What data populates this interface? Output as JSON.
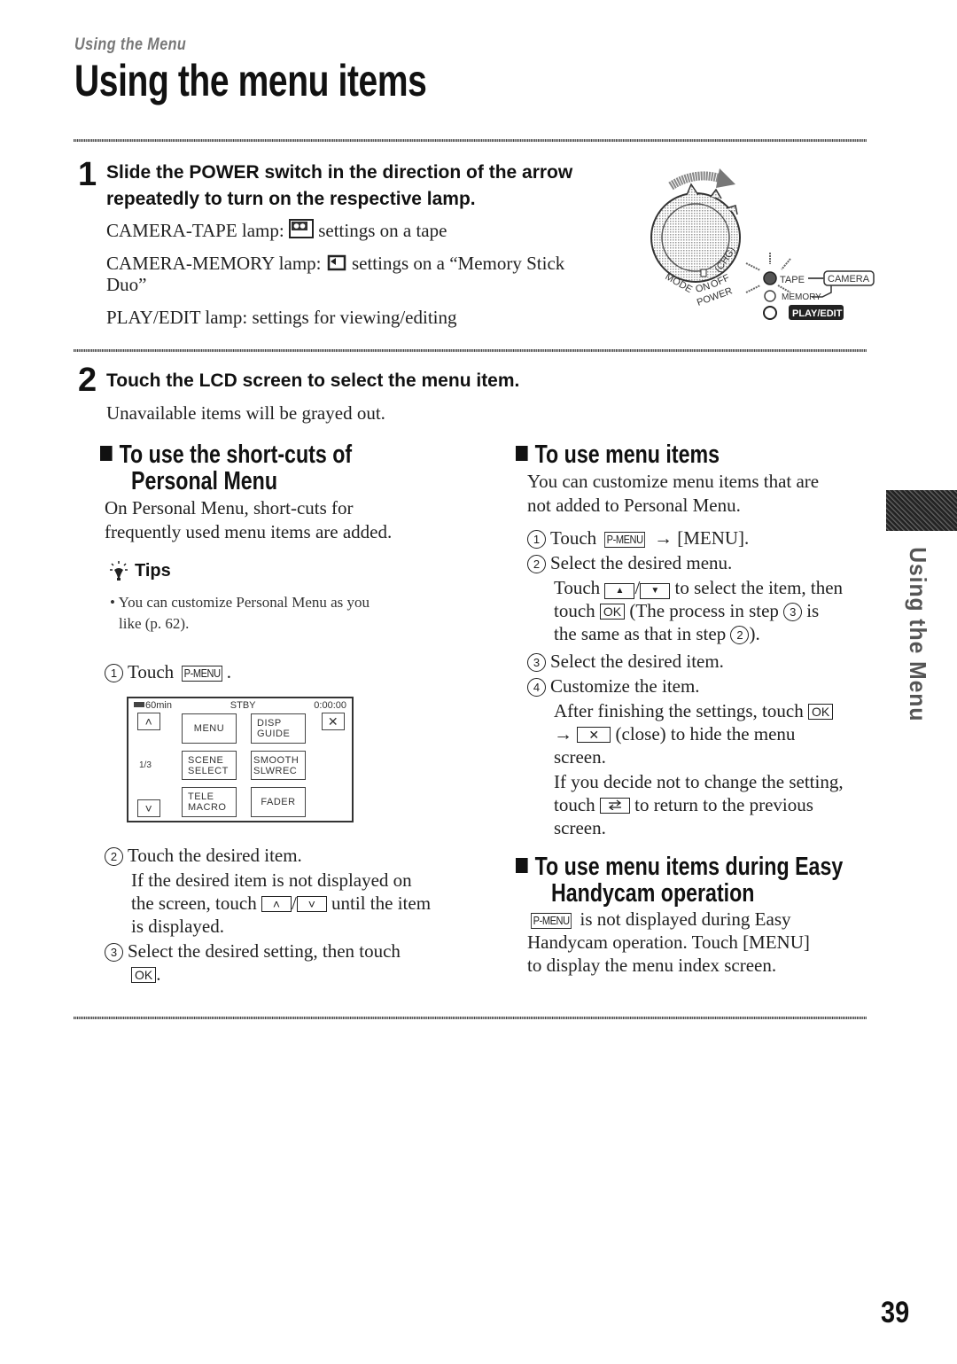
{
  "header": {
    "breadcrumb": "Using the Menu",
    "title": "Using the menu items"
  },
  "step1": {
    "number": "1",
    "heading_line1": "Slide the POWER switch in the direction of the arrow",
    "heading_line2": "repeatedly to turn on the respective lamp.",
    "lamps": [
      {
        "label": "CAMERA-TAPE lamp:",
        "icon": "tape-icon",
        "desc": "settings on a tape"
      },
      {
        "label": "CAMERA-MEMORY lamp:",
        "icon": "memory-stick-icon",
        "desc": "settings on a “Memory Stick"
      },
      {
        "continuation": "Duo”"
      },
      {
        "label": "PLAY/EDIT lamp:",
        "desc": "settings for viewing/editing"
      }
    ],
    "illustration": {
      "mode_label": "MODE",
      "on_label": "ON",
      "off_label": "OFF",
      "chg_label": "(CHG)",
      "power_label": "POWER",
      "tape_label": "TAPE",
      "memory_label": "MEMORY",
      "camera_label": "CAMERA",
      "playedit_label": "PLAY/EDIT"
    }
  },
  "step2": {
    "number": "2",
    "heading": "Touch the LCD screen to select the menu item.",
    "note": "Unavailable items will be grayed out."
  },
  "left_section": {
    "heading_line1": "To use the short-cuts of",
    "heading_line2": "Personal Menu",
    "body_line1": "On Personal Menu, short-cuts for",
    "body_line2": "frequently used menu items are added.",
    "tips_title": "Tips",
    "tip_line1": "You can customize Personal Menu as you",
    "tip_line2": "like (p. 62).",
    "step1_text": "Touch",
    "step1_key": "P-MENU",
    "lcd": {
      "battery": "60min",
      "status": "STBY",
      "timecode": "0:00:00",
      "page": "1/3",
      "buttons": {
        "up": "˄",
        "down": "˅",
        "close": "✕",
        "menu": "MENU",
        "disp_guide_1": "DISP",
        "disp_guide_2": "GUIDE",
        "scene_1": "SCENE",
        "scene_2": "SELECT",
        "smooth_1": "SMOOTH",
        "smooth_2": "SLWREC",
        "tele_1": "TELE",
        "tele_2": "MACRO",
        "fader": "FADER"
      }
    },
    "step2_text": "Touch the desired item.",
    "step2_detail_1": "If the desired item is not displayed on",
    "step2_detail_2a": "the screen, touch",
    "step2_detail_2b": "until the item",
    "step2_detail_3": "is displayed.",
    "step3_text": "Select the desired setting, then touch",
    "ok_key": "OK"
  },
  "right_section": {
    "heading": "To use menu items",
    "body_line1": "You can customize menu items that are",
    "body_line2": "not added to Personal Menu.",
    "s1_text": "Touch",
    "s1_key": "P-MENU",
    "s1_after": "→ [MENU].",
    "s2_text": "Select the desired menu.",
    "s2_d1a": "Touch",
    "s2_d1b": "to select the item, then",
    "s2_d2a": "touch",
    "s2_d2b": "(The process in step",
    "s2_d2c": "is",
    "s2_d3a": "the same as that in step",
    "s2_d3b": ").",
    "s3_text": "Select the desired item.",
    "s4_text": "Customize the item.",
    "s4_d1": "After finishing the settings, touch",
    "s4_d2": "(close) to hide the menu",
    "s4_d3": "screen.",
    "s4_d4": "If you decide not to change the setting,",
    "s4_d5a": "touch",
    "s4_d5b": "to return to the previous",
    "s4_d6": "screen.",
    "ok_key": "OK",
    "close_key": "✕",
    "arrow": "→",
    "easy_heading_1": "To use menu items during Easy",
    "easy_heading_2": "Handycam operation",
    "easy_key": "P-MENU",
    "easy_l1": "is not displayed during Easy",
    "easy_l2": "Handycam operation. Touch [MENU]",
    "easy_l3": "to display the menu index screen."
  },
  "side_tab": {
    "label": "Using the Menu"
  },
  "page_number": "39"
}
